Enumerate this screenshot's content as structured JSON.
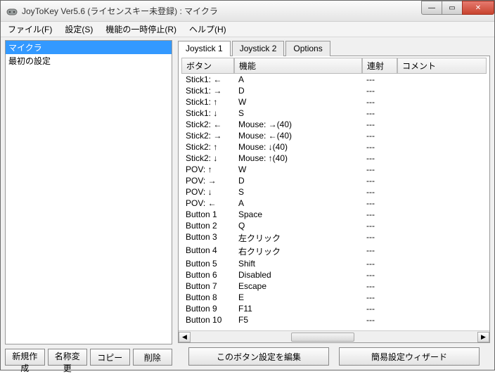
{
  "window": {
    "title": "JoyToKey Ver5.6 (ライセンスキー未登録) : マイクラ"
  },
  "controls": {
    "min": "—",
    "max": "▭",
    "close": "✕"
  },
  "menu": {
    "file": "ファイル(F)",
    "settings": "設定(S)",
    "pause": "機能の一時停止(R)",
    "help": "ヘルプ(H)"
  },
  "profiles": {
    "items": [
      {
        "label": "マイクラ",
        "selected": true
      },
      {
        "label": "最初の設定",
        "selected": false
      }
    ]
  },
  "profile_buttons": {
    "new": "新規作成",
    "rename": "名称変更",
    "copy": "コピー",
    "delete": "削除"
  },
  "tabs": {
    "items": [
      {
        "label": "Joystick 1",
        "active": true
      },
      {
        "label": "Joystick 2",
        "active": false
      },
      {
        "label": "Options",
        "active": false
      }
    ]
  },
  "columns": {
    "button": "ボタン",
    "function": "機能",
    "turbo": "連射",
    "comment": "コメント"
  },
  "mappings": [
    {
      "button": "Stick1: ←",
      "function": "A",
      "turbo": "---",
      "comment": ""
    },
    {
      "button": "Stick1: →",
      "function": "D",
      "turbo": "---",
      "comment": ""
    },
    {
      "button": "Stick1: ↑",
      "function": "W",
      "turbo": "---",
      "comment": ""
    },
    {
      "button": "Stick1: ↓",
      "function": "S",
      "turbo": "---",
      "comment": ""
    },
    {
      "button": "Stick2: ←",
      "function": "Mouse: →(40)",
      "turbo": "---",
      "comment": ""
    },
    {
      "button": "Stick2: →",
      "function": "Mouse: ←(40)",
      "turbo": "---",
      "comment": ""
    },
    {
      "button": "Stick2: ↑",
      "function": "Mouse: ↓(40)",
      "turbo": "---",
      "comment": ""
    },
    {
      "button": "Stick2: ↓",
      "function": "Mouse: ↑(40)",
      "turbo": "---",
      "comment": ""
    },
    {
      "button": "POV: ↑",
      "function": "W",
      "turbo": "---",
      "comment": ""
    },
    {
      "button": "POV: →",
      "function": "D",
      "turbo": "---",
      "comment": ""
    },
    {
      "button": "POV: ↓",
      "function": "S",
      "turbo": "---",
      "comment": ""
    },
    {
      "button": "POV: ←",
      "function": "A",
      "turbo": "---",
      "comment": ""
    },
    {
      "button": "Button 1",
      "function": "Space",
      "turbo": "---",
      "comment": ""
    },
    {
      "button": "Button 2",
      "function": "Q",
      "turbo": "---",
      "comment": ""
    },
    {
      "button": "Button 3",
      "function": "左クリック",
      "turbo": "---",
      "comment": ""
    },
    {
      "button": "Button 4",
      "function": "右クリック",
      "turbo": "---",
      "comment": ""
    },
    {
      "button": "Button 5",
      "function": "Shift",
      "turbo": "---",
      "comment": ""
    },
    {
      "button": "Button 6",
      "function": "Disabled",
      "turbo": "---",
      "comment": ""
    },
    {
      "button": "Button 7",
      "function": "Escape",
      "turbo": "---",
      "comment": ""
    },
    {
      "button": "Button 8",
      "function": "E",
      "turbo": "---",
      "comment": ""
    },
    {
      "button": "Button 9",
      "function": "F11",
      "turbo": "---",
      "comment": ""
    },
    {
      "button": "Button 10",
      "function": "F5",
      "turbo": "---",
      "comment": ""
    }
  ],
  "bottom_buttons": {
    "edit": "このボタン設定を編集",
    "wizard": "簡易設定ウィザード"
  },
  "scroll": {
    "left": "◀",
    "right": "▶",
    "grip": "▥"
  }
}
